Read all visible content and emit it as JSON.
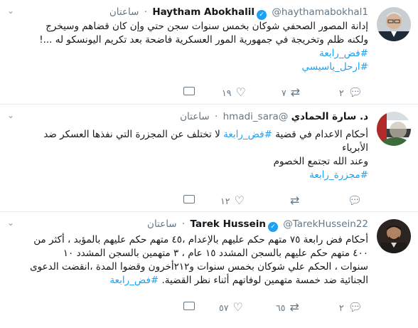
{
  "tweets": [
    {
      "name": "Haytham Abokhalil",
      "handle": "@haythamabokhal1",
      "time": "ساعتان",
      "lines": [
        "إدانة المصور الصحفي شوكان بخمس سنوات سجن حتي وإن كان قضاهم وسيخرج",
        "ولكنه ظلم وتخريجة في جمهورية المور العسكرية فاضحة بعد تكريم اليونسكو له ...!"
      ],
      "hashtags": [
        "#فض_رابعة",
        "#ارحل_ياسيسي"
      ],
      "replies": "٢",
      "retweets": "٧",
      "likes": "١٩"
    },
    {
      "name": "د. سارة الحمادي",
      "handle": "@hmadi_sara",
      "time": "ساعتان",
      "line1_pre": "أحكام الاعدام في قضية",
      "line1_tag": "#فض_رابعة",
      "line1_post": "لا تختلف عن المجزرة التي نفذها العسكر ضد",
      "line2": "الأبرياء",
      "line3": "وعند الله تجتمع الخصوم",
      "tag2": "#مجزرة_رابعة",
      "replies": "",
      "retweets": "",
      "likes": "١٢"
    },
    {
      "name": "Tarek Hussein",
      "handle": "@TarekHussein22",
      "time": "ساعتان",
      "lines": [
        "أحكام فض رابعة ٧٥ متهم حكم عليهم بالإعدام ،٤٥ متهم حكم  عليهم بالمؤبد ، أكثر من",
        "٤٠٠ متهم حكم عليهم بالسجن المشدد ١٥ عام ، ٣ متهمين بالسجن المشدد ١٠",
        "سنوات ، الحكم علي شوكان بخمس سنوات و٢١٢أخرون وقضوا المدة ،انقضت الدعوى",
        "الجنائية ضد خمسة متهمين لوفاتهم أثناء نظر القضية."
      ],
      "hashtag": "#فض_رابعة",
      "replies": "٢",
      "retweets": "٦٥",
      "likes": "٥٧"
    }
  ]
}
